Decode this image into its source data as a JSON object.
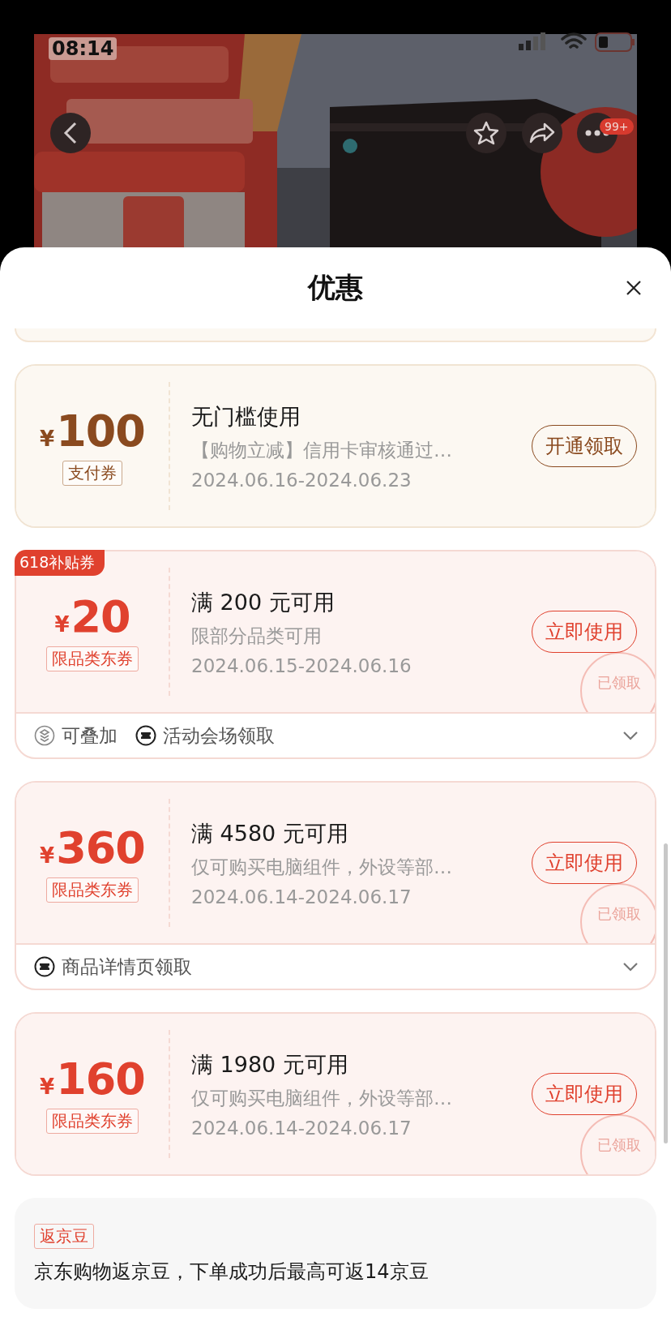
{
  "status_bar": {
    "time": "08:14"
  },
  "background_page": {
    "kind": "picture",
    "badge": "99+"
  },
  "sheet": {
    "title": "优惠"
  },
  "coupons": [
    {
      "kind": "payment",
      "currency": "¥",
      "amount": "100",
      "type_label": "支付券",
      "title": "无门槛使用",
      "description": "【购物立减】信用卡审核通过…",
      "validity": "2024.06.16-2024.06.23",
      "button": "开通领取"
    },
    {
      "kind": "category",
      "tag": "618补贴券",
      "currency": "¥",
      "amount": "20",
      "type_label": "限品类东券",
      "title": "满 200 元可用",
      "description": "限部分品类可用",
      "validity": "2024.06.15-2024.06.16",
      "button": "立即使用",
      "stamp": "已领取",
      "footer": {
        "expanded": false,
        "items": [
          {
            "kind": "stackable",
            "text": "可叠加"
          },
          {
            "kind": "source",
            "text": "活动会场领取"
          }
        ]
      }
    },
    {
      "kind": "category",
      "currency": "¥",
      "amount": "360",
      "type_label": "限品类东券",
      "title": "满 4580 元可用",
      "description": "仅可购买电脑组件，外设等部…",
      "validity": "2024.06.14-2024.06.17",
      "button": "立即使用",
      "stamp": "已领取",
      "footer": {
        "expanded": false,
        "items": [
          {
            "kind": "source",
            "text": "商品详情页领取"
          }
        ]
      }
    },
    {
      "kind": "category",
      "currency": "¥",
      "amount": "160",
      "type_label": "限品类东券",
      "title": "满 1980 元可用",
      "description": "仅可购买电脑组件，外设等部…",
      "validity": "2024.06.14-2024.06.17",
      "button": "立即使用",
      "stamp": "已领取"
    }
  ],
  "bean_card": {
    "tag": "返京豆",
    "text": "京东购物返京豆，下单成功后最高可返14京豆"
  }
}
